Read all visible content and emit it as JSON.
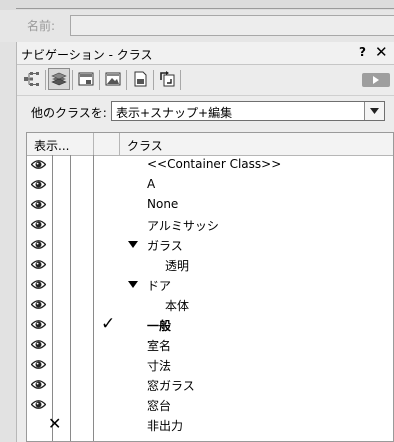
{
  "name_row": {
    "label": "名前:"
  },
  "panel": {
    "title": "ナビゲーション - クラス",
    "help": "?",
    "close": "✕"
  },
  "toolbar": {
    "icons": [
      "class-tree-icon",
      "layers-icon",
      "viewport-icon",
      "image-icon",
      "document-icon",
      "reference-icon"
    ],
    "active_index": 1,
    "play_icon": "play-icon"
  },
  "filter": {
    "label": "他のクラスを:",
    "value": "表示+スナップ+編集"
  },
  "list": {
    "headers": {
      "visibility": "表示...",
      "class": "クラス"
    },
    "rows": [
      {
        "name": "<<Container Class>>",
        "visible": true
      },
      {
        "name": "A",
        "visible": true
      },
      {
        "name": "None",
        "visible": true
      },
      {
        "name": "アルミサッシ",
        "visible": true
      },
      {
        "name": "ガラス",
        "visible": true,
        "expanded": true
      },
      {
        "name": "透明",
        "visible": true,
        "indent": 1
      },
      {
        "name": "ドア",
        "visible": true,
        "expanded": true
      },
      {
        "name": "本体",
        "visible": true,
        "indent": 1
      },
      {
        "name": "一般",
        "visible": true,
        "active": true
      },
      {
        "name": "室名",
        "visible": true
      },
      {
        "name": "寸法",
        "visible": true
      },
      {
        "name": "窓ガラス",
        "visible": true
      },
      {
        "name": "窓台",
        "visible": true
      },
      {
        "name": "非出力",
        "visible": false
      }
    ],
    "active_mark": "✓",
    "hidden_mark": "✕"
  }
}
